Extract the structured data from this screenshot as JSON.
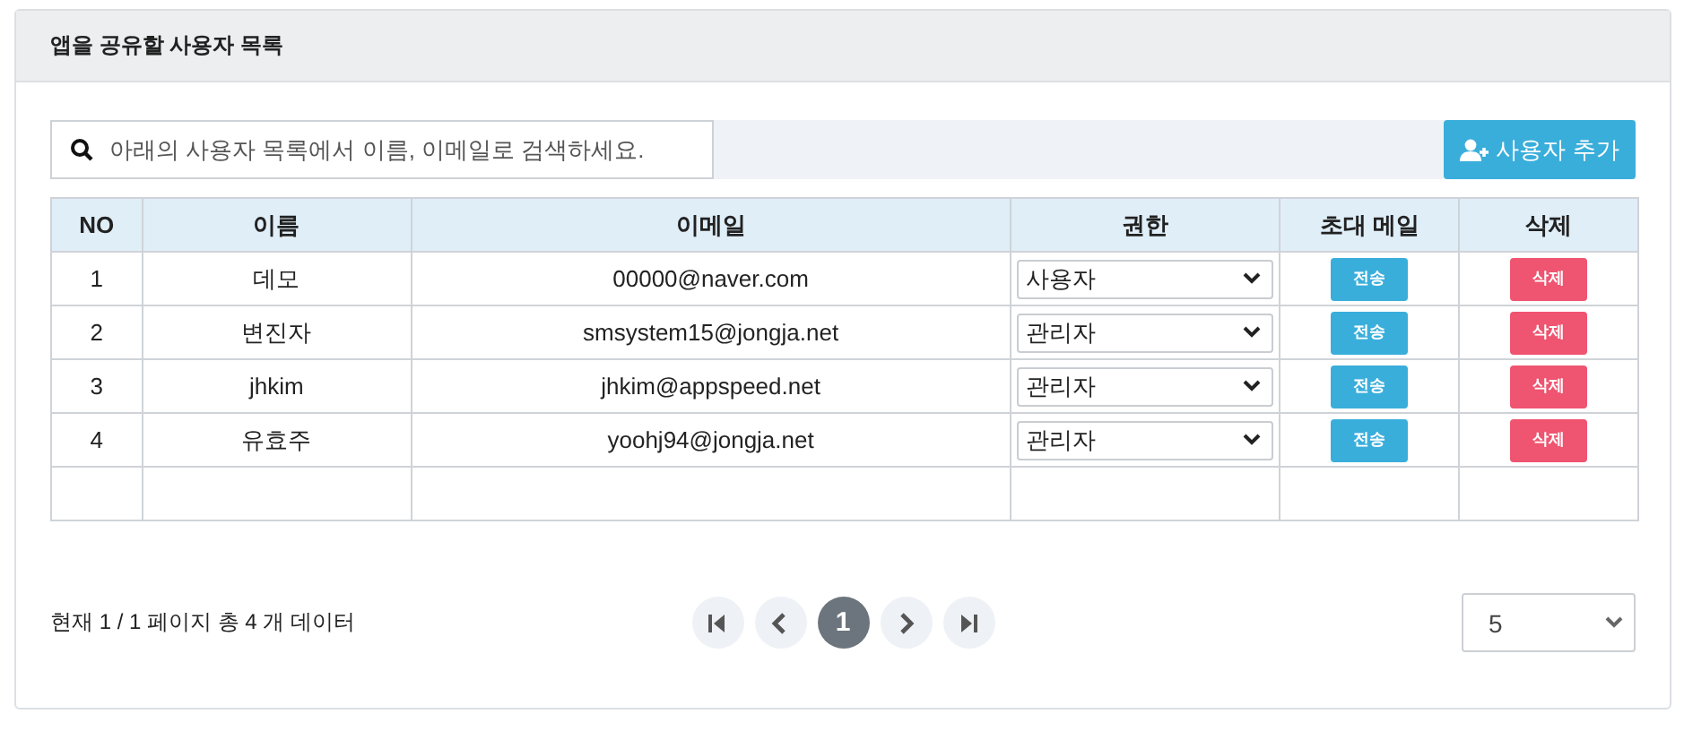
{
  "panel": {
    "title": "앱을 공유할 사용자 목록"
  },
  "search": {
    "placeholder": "아래의 사용자 목록에서 이름, 이메일로 검색하세요."
  },
  "add_button": {
    "label": "사용자 추가"
  },
  "table": {
    "columns": [
      "NO",
      "이름",
      "이메일",
      "권한",
      "초대 메일",
      "삭제"
    ],
    "rows": [
      {
        "no": "1",
        "name": "데모",
        "email": "00000@naver.com",
        "role": "사용자",
        "invite": "전송",
        "delete": "삭제"
      },
      {
        "no": "2",
        "name": "변진자",
        "email": "smsystem15@jongja.net",
        "role": "관리자",
        "invite": "전송",
        "delete": "삭제"
      },
      {
        "no": "3",
        "name": "jhkim",
        "email": "jhkim@appspeed.net",
        "role": "관리자",
        "invite": "전송",
        "delete": "삭제"
      },
      {
        "no": "4",
        "name": "유효주",
        "email": "yoohj94@jongja.net",
        "role": "관리자",
        "invite": "전송",
        "delete": "삭제"
      }
    ]
  },
  "footer": {
    "status": "현재 1 / 1 페이지 총 4 개 데이터",
    "pages": [
      {
        "label": "1",
        "selected": true
      }
    ],
    "page_size": "5"
  }
}
